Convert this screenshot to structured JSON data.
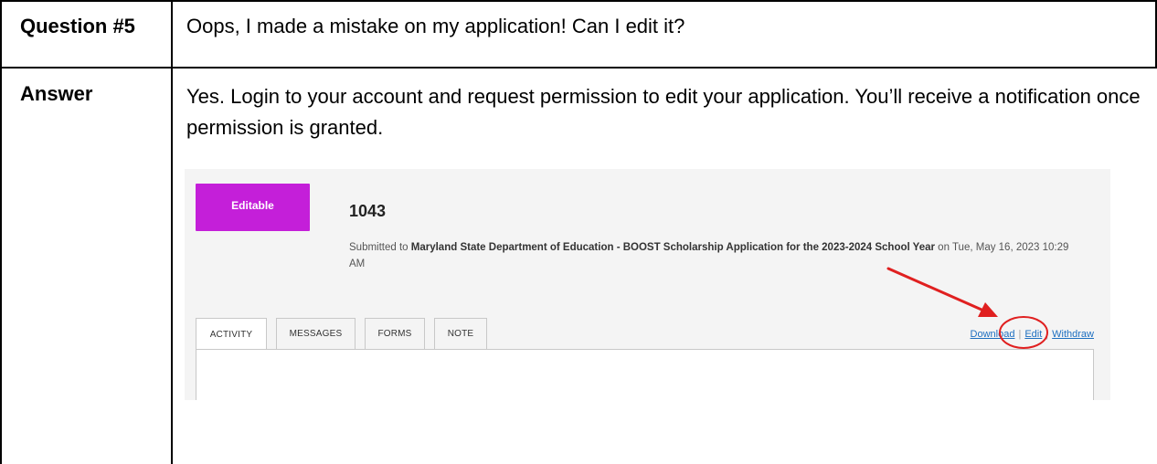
{
  "question": {
    "label": "Question #5",
    "text": "Oops, I made a mistake on my application! Can I edit it?"
  },
  "answer": {
    "label": "Answer",
    "text": "Yes. Login to your account and request permission to edit your application. You’ll receive a notification once permission is granted."
  },
  "screenshot": {
    "status_badge": "Editable",
    "application_id": "1043",
    "submitted_prefix": "Submitted to ",
    "submitted_program": "Maryland State Department of Education - BOOST Scholarship Application for the 2023-2024 School Year",
    "submitted_suffix": " on Tue, May 16, 2023 10:29 AM",
    "tabs": [
      {
        "label": "ACTIVITY"
      },
      {
        "label": "MESSAGES"
      },
      {
        "label": "FORMS"
      },
      {
        "label": "NOTE"
      }
    ],
    "links": {
      "download": "Download",
      "edit": "Edit",
      "withdraw": "Withdraw",
      "separator": "|"
    },
    "colors": {
      "badge": "#c41fd9",
      "link": "#1e6fc0",
      "annotation": "#e02020"
    }
  }
}
